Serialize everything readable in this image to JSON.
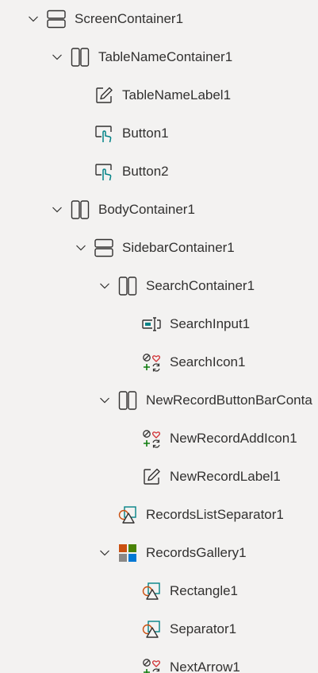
{
  "tree": {
    "nodes": [
      {
        "id": "screen-container-1",
        "label": "ScreenContainer1",
        "icon": "vertical-container-icon",
        "expanded": true,
        "depth": 0
      },
      {
        "id": "table-name-container-1",
        "label": "TableNameContainer1",
        "icon": "horizontal-container-icon",
        "expanded": true,
        "depth": 1
      },
      {
        "id": "table-name-label-1",
        "label": "TableNameLabel1",
        "icon": "label-edit-icon",
        "depth": 2
      },
      {
        "id": "button-1",
        "label": "Button1",
        "icon": "button-pointer-icon",
        "depth": 2
      },
      {
        "id": "button-2",
        "label": "Button2",
        "icon": "button-pointer-icon",
        "depth": 2
      },
      {
        "id": "body-container-1",
        "label": "BodyContainer1",
        "icon": "horizontal-container-icon",
        "expanded": true,
        "depth": 1
      },
      {
        "id": "sidebar-container-1",
        "label": "SidebarContainer1",
        "icon": "vertical-container-icon",
        "expanded": true,
        "depth": 2
      },
      {
        "id": "search-container-1",
        "label": "SearchContainer1",
        "icon": "horizontal-container-icon",
        "expanded": true,
        "depth": 3
      },
      {
        "id": "search-input-1",
        "label": "SearchInput1",
        "icon": "text-input-icon",
        "depth": 4
      },
      {
        "id": "search-icon-1",
        "label": "SearchIcon1",
        "icon": "icons-control-icon",
        "depth": 4
      },
      {
        "id": "new-record-button-bar-container",
        "label": "NewRecordButtonBarConta",
        "icon": "horizontal-container-icon",
        "expanded": true,
        "depth": 3
      },
      {
        "id": "new-record-add-icon-1",
        "label": "NewRecordAddIcon1",
        "icon": "icons-control-icon",
        "depth": 4
      },
      {
        "id": "new-record-label-1",
        "label": "NewRecordLabel1",
        "icon": "label-edit-icon",
        "depth": 4
      },
      {
        "id": "records-list-separator-1",
        "label": "RecordsListSeparator1",
        "icon": "shapes-icon",
        "depth": 2
      },
      {
        "id": "records-gallery-1",
        "label": "RecordsGallery1",
        "icon": "gallery-icon",
        "expanded": true,
        "depth": 2
      },
      {
        "id": "rectangle-1",
        "label": "Rectangle1",
        "icon": "shapes-icon",
        "depth": 3
      },
      {
        "id": "separator-1",
        "label": "Separator1",
        "icon": "shapes-icon",
        "depth": 3
      },
      {
        "id": "next-arrow-1",
        "label": "NextArrow1",
        "icon": "icons-control-icon",
        "depth": 3
      }
    ]
  },
  "colors": {
    "background": "#f3f2f1",
    "text": "#323130",
    "icon_stroke": "#323130",
    "accent_teal": "#038387",
    "icon_red": "#d13438",
    "icon_green": "#107c10",
    "gallery_orange": "#ca5010",
    "gallery_green": "#498205",
    "gallery_blue": "#0078d4",
    "gallery_gray": "#8a8886"
  }
}
